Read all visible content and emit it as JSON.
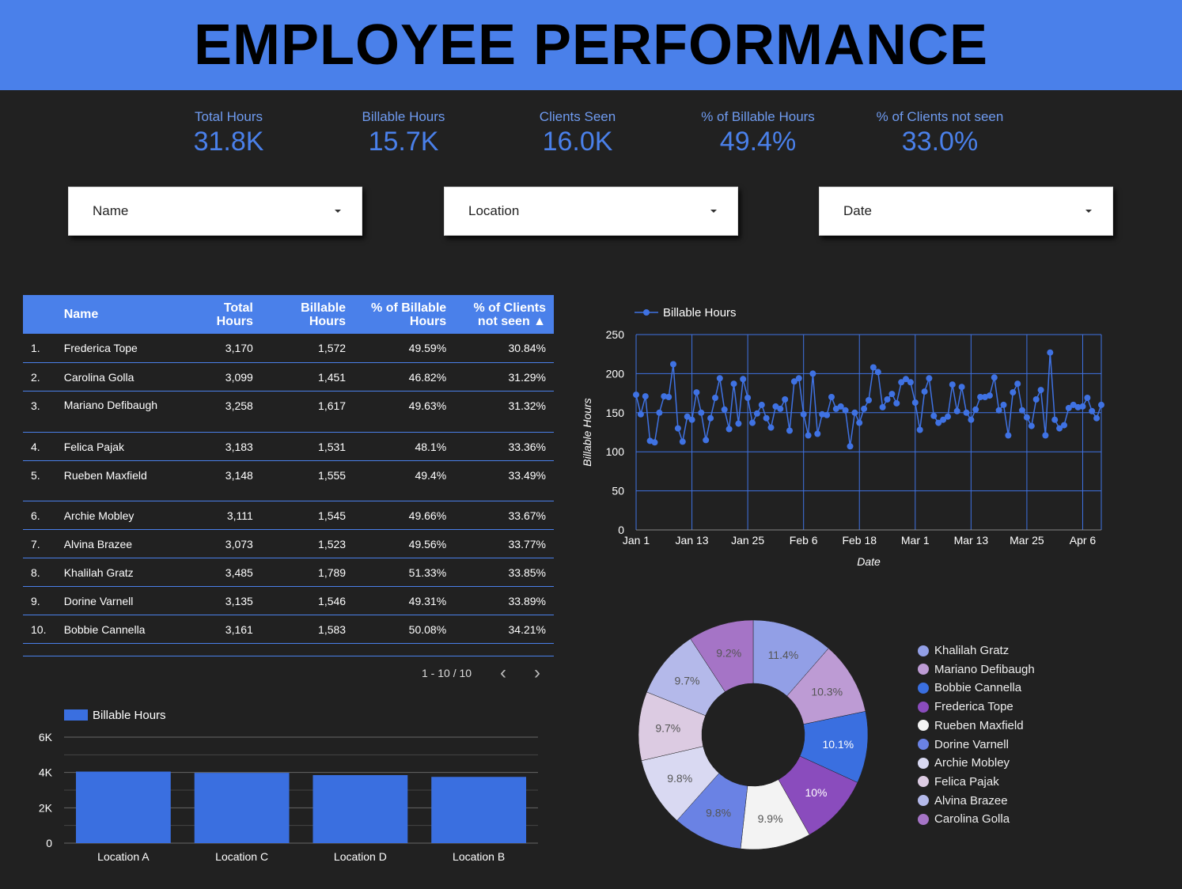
{
  "title": "EMPLOYEE PERFORMANCE",
  "kpis": [
    {
      "label": "Total Hours",
      "value": "31.8K"
    },
    {
      "label": "Billable Hours",
      "value": "15.7K"
    },
    {
      "label": "Clients Seen",
      "value": "16.0K"
    },
    {
      "label": "% of Billable Hours",
      "value": "49.4%"
    },
    {
      "label": "% of Clients not seen",
      "value": "33.0%"
    }
  ],
  "filters": [
    {
      "label": "Name"
    },
    {
      "label": "Location"
    },
    {
      "label": "Date"
    }
  ],
  "table": {
    "headers": {
      "name": "Name",
      "total": "Total Hours",
      "billable": "Billable Hours",
      "pct_billable": "% of Billable Hours",
      "pct_clients": "% of Clients not seen ▲"
    },
    "rows": [
      {
        "idx": "1.",
        "name": "Frederica Tope",
        "total": "3,170",
        "billable": "1,572",
        "pct_billable": "49.59%",
        "pct_clients": "30.84%"
      },
      {
        "idx": "2.",
        "name": "Carolina Golla",
        "total": "3,099",
        "billable": "1,451",
        "pct_billable": "46.82%",
        "pct_clients": "31.29%"
      },
      {
        "idx": "3.",
        "name": "Mariano Defibaugh",
        "total": "3,258",
        "billable": "1,617",
        "pct_billable": "49.63%",
        "pct_clients": "31.32%"
      },
      {
        "idx": "4.",
        "name": "Felica Pajak",
        "total": "3,183",
        "billable": "1,531",
        "pct_billable": "48.1%",
        "pct_clients": "33.36%"
      },
      {
        "idx": "5.",
        "name": "Rueben Maxfield",
        "total": "3,148",
        "billable": "1,555",
        "pct_billable": "49.4%",
        "pct_clients": "33.49%"
      },
      {
        "idx": "6.",
        "name": "Archie Mobley",
        "total": "3,111",
        "billable": "1,545",
        "pct_billable": "49.66%",
        "pct_clients": "33.67%"
      },
      {
        "idx": "7.",
        "name": "Alvina Brazee",
        "total": "3,073",
        "billable": "1,523",
        "pct_billable": "49.56%",
        "pct_clients": "33.77%"
      },
      {
        "idx": "8.",
        "name": "Khalilah Gratz",
        "total": "3,485",
        "billable": "1,789",
        "pct_billable": "51.33%",
        "pct_clients": "33.85%"
      },
      {
        "idx": "9.",
        "name": "Dorine Varnell",
        "total": "3,135",
        "billable": "1,546",
        "pct_billable": "49.31%",
        "pct_clients": "33.89%"
      },
      {
        "idx": "10.",
        "name": "Bobbie Cannella",
        "total": "3,161",
        "billable": "1,583",
        "pct_billable": "50.08%",
        "pct_clients": "34.21%"
      }
    ],
    "pager": "1 - 10 / 10"
  },
  "colors": {
    "accent": "#4a80ea",
    "bar": "#3a6fe0",
    "line": "#3f72e3"
  },
  "chart_data": [
    {
      "type": "line",
      "legend": "Billable Hours",
      "xlabel": "Date",
      "ylabel": "Billable Hours",
      "ylim": [
        0,
        250
      ],
      "yticks": [
        0,
        50,
        100,
        150,
        200,
        250
      ],
      "xticks": [
        "Jan 1",
        "Jan 13",
        "Jan 25",
        "Feb 6",
        "Feb 18",
        "Mar 1",
        "Mar 13",
        "Mar 25",
        "Apr 6"
      ],
      "x_start": "Jan 1",
      "values": [
        173,
        148,
        171,
        114,
        112,
        150,
        171,
        170,
        212,
        130,
        113,
        145,
        141,
        176,
        150,
        115,
        143,
        169,
        194,
        154,
        129,
        187,
        136,
        193,
        169,
        137,
        149,
        160,
        143,
        131,
        158,
        155,
        167,
        127,
        190,
        194,
        148,
        121,
        200,
        123,
        148,
        147,
        170,
        155,
        158,
        153,
        107,
        150,
        137,
        155,
        166,
        208,
        202,
        157,
        167,
        174,
        162,
        189,
        193,
        189,
        163,
        128,
        177,
        194,
        146,
        137,
        141,
        145,
        186,
        152,
        183,
        150,
        141,
        154,
        170,
        170,
        172,
        195,
        153,
        160,
        121,
        176,
        187,
        153,
        144,
        133,
        167,
        179,
        121,
        227,
        141,
        130,
        134,
        156,
        160,
        157,
        158,
        169,
        152,
        143,
        160
      ]
    },
    {
      "type": "bar",
      "legend": "Billable Hours",
      "categories": [
        "Location A",
        "Location C",
        "Location D",
        "Location B"
      ],
      "values": [
        4050,
        3980,
        3850,
        3750
      ],
      "ylim": [
        0,
        6000
      ],
      "ytick_labels": [
        "0",
        "2K",
        "4K",
        "6K"
      ],
      "yticks": [
        0,
        2000,
        4000,
        6000
      ]
    },
    {
      "type": "pie",
      "donut": true,
      "slices": [
        {
          "name": "Khalilah Gratz",
          "value": 11.4,
          "label": "11.4%",
          "color": "#929fe6"
        },
        {
          "name": "Mariano Defibaugh",
          "value": 10.3,
          "label": "10.3%",
          "color": "#bd9bd4"
        },
        {
          "name": "Bobbie Cannella",
          "value": 10.1,
          "label": "10.1%",
          "color": "#3a6fe0"
        },
        {
          "name": "Frederica Tope",
          "value": 10.0,
          "label": "10%",
          "color": "#8a4cbd"
        },
        {
          "name": "Rueben Maxfield",
          "value": 9.9,
          "label": "9.9%",
          "color": "#f3f3f3"
        },
        {
          "name": "Dorine Varnell",
          "value": 9.8,
          "label": "9.8%",
          "color": "#6a82e4"
        },
        {
          "name": "Archie Mobley",
          "value": 9.8,
          "label": "9.8%",
          "color": "#d9d9f2"
        },
        {
          "name": "Felica Pajak",
          "value": 9.7,
          "label": "9.7%",
          "color": "#dccbe2"
        },
        {
          "name": "Alvina Brazee",
          "value": 9.7,
          "label": "9.7%",
          "color": "#b4b9ea"
        },
        {
          "name": "Carolina Golla",
          "value": 9.2,
          "label": "9.2%",
          "color": "#a574c6"
        }
      ]
    }
  ]
}
